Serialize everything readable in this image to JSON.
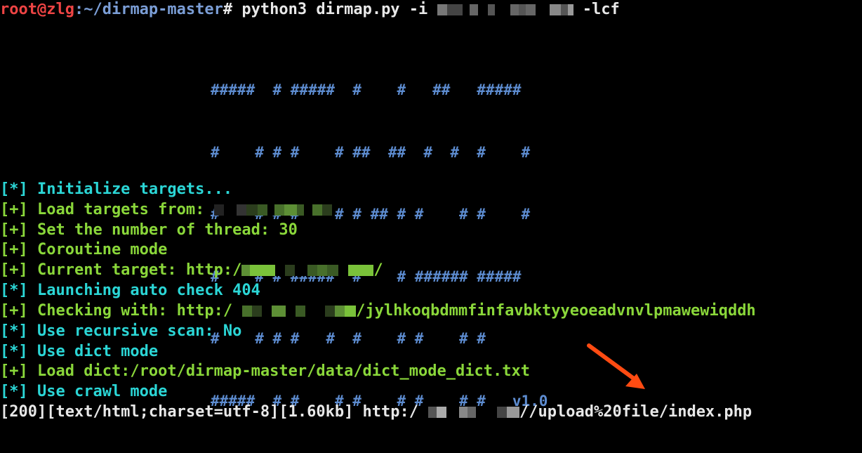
{
  "prompt": {
    "user_host": "root@zlg",
    "path": ":~/dirmap-master",
    "symbol": "#",
    "command_start": " python3 dirmap.py -i ",
    "command_end": " -lcf"
  },
  "banner": {
    "lines": [
      "#####  # #####  #    #   ##   #####",
      "#    # # #    # ##  ##  #  #  #    #",
      "#    # # #    # # ## # #    # #    #",
      "#    # # #####  #    # ###### #####",
      "#    # # #   #  #    # #    # #",
      "#####  # #    # #    # #    # #"
    ],
    "version": "v1.0"
  },
  "log": {
    "init": "[*] Initialize targets...",
    "load_targets": "[+] Load targets from: ",
    "threads": "[+] Set the number of thread: 30",
    "coroutine": "[+] Coroutine mode",
    "current_target_prefix": "[+] Current target: http:/",
    "current_target_suffix": "/",
    "auto_check": "[*] Launching auto check 404",
    "checking_prefix": "[+] Checking with: http:/",
    "checking_suffix": "/jylhkoqbdmmfinfavbktyyeoeadvnvlpmawewiqddh",
    "recursive": "[*] Use recursive scan: No",
    "dict_mode": "[*] Use dict mode",
    "load_dict": "[+] Load dict:/root/dirmap-master/data/dict_mode_dict.txt",
    "crawl_mode": "[*] Use crawl mode",
    "result_prefix": "[200][text/html;charset=utf-8][1.60kb] http:/",
    "result_suffix": "//upload%20file/index.php"
  },
  "colors": {
    "background": "#000000",
    "user": "#ee4444",
    "path": "#7b9ed6",
    "banner": "#5d8cd0",
    "info": "#2bd6d6",
    "success": "#8ad73a",
    "arrow": "#ff4b12"
  },
  "icons": {
    "annotation": "arrow-pointer-icon"
  }
}
